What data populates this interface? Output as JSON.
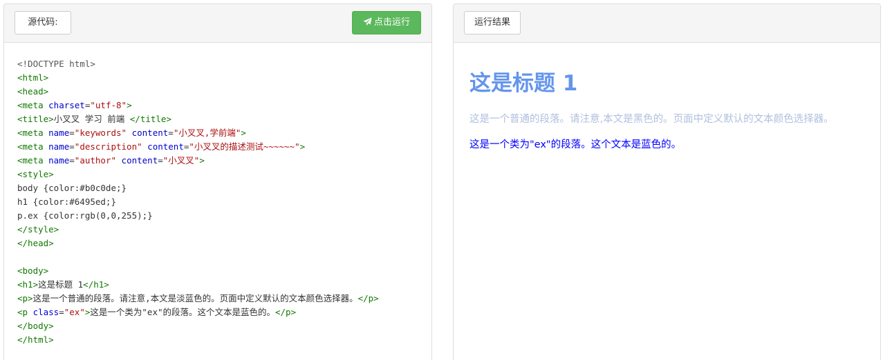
{
  "source_panel": {
    "label": "源代码:",
    "run_button": "点击运行",
    "code": [
      [
        [
          "meta",
          "<!DOCTYPE html>"
        ]
      ],
      [
        [
          "tag",
          "<html>"
        ]
      ],
      [
        [
          "tag",
          "<head>"
        ]
      ],
      [
        [
          "tag",
          "<meta "
        ],
        [
          "attr",
          "charset"
        ],
        [
          "prop",
          "="
        ],
        [
          "str",
          "\"utf-8\""
        ],
        [
          "tag",
          ">"
        ]
      ],
      [
        [
          "tag",
          "<title>"
        ],
        [
          "prop",
          "小叉叉 学习 前端 "
        ],
        [
          "tag",
          "</title>"
        ]
      ],
      [
        [
          "tag",
          "<meta "
        ],
        [
          "attr",
          "name"
        ],
        [
          "prop",
          "="
        ],
        [
          "str",
          "\"keywords\""
        ],
        [
          "prop",
          " "
        ],
        [
          "attr",
          "content"
        ],
        [
          "prop",
          "="
        ],
        [
          "str",
          "\"小叉叉,学前端\""
        ],
        [
          "tag",
          ">"
        ]
      ],
      [
        [
          "tag",
          "<meta "
        ],
        [
          "attr",
          "name"
        ],
        [
          "prop",
          "="
        ],
        [
          "str",
          "\"description\""
        ],
        [
          "prop",
          " "
        ],
        [
          "attr",
          "content"
        ],
        [
          "prop",
          "="
        ],
        [
          "str",
          "\"小叉叉的描述测试~~~~~~\""
        ],
        [
          "tag",
          ">"
        ]
      ],
      [
        [
          "tag",
          "<meta "
        ],
        [
          "attr",
          "name"
        ],
        [
          "prop",
          "="
        ],
        [
          "str",
          "\"author\""
        ],
        [
          "prop",
          " "
        ],
        [
          "attr",
          "content"
        ],
        [
          "prop",
          "="
        ],
        [
          "str",
          "\"小叉叉\""
        ],
        [
          "tag",
          ">"
        ]
      ],
      [
        [
          "tag",
          "<style>"
        ]
      ],
      [
        [
          "prop",
          "body {color:#b0c0de;}"
        ]
      ],
      [
        [
          "prop",
          "h1 {color:#6495ed;}"
        ]
      ],
      [
        [
          "prop",
          "p.ex {color:rgb(0,0,255);}"
        ]
      ],
      [
        [
          "tag",
          "</style>"
        ]
      ],
      [
        [
          "tag",
          "</head>"
        ]
      ],
      [
        [
          "prop",
          ""
        ]
      ],
      [
        [
          "tag",
          "<body>"
        ]
      ],
      [
        [
          "tag",
          "<h1>"
        ],
        [
          "prop",
          "这是标题 1"
        ],
        [
          "tag",
          "</h1>"
        ]
      ],
      [
        [
          "tag",
          "<p>"
        ],
        [
          "prop",
          "这是一个普通的段落。请注意,本文是淡蓝色的。页面中定义默认的文本颜色选择器。"
        ],
        [
          "tag",
          "</p>"
        ]
      ],
      [
        [
          "tag",
          "<p "
        ],
        [
          "attr",
          "class"
        ],
        [
          "prop",
          "="
        ],
        [
          "str",
          "\"ex\""
        ],
        [
          "tag",
          ">"
        ],
        [
          "prop",
          "这是一个类为\"ex\"的段落。这个文本是蓝色的。"
        ],
        [
          "tag",
          "</p>"
        ]
      ],
      [
        [
          "tag",
          "</body>"
        ]
      ],
      [
        [
          "tag",
          "</html>"
        ]
      ]
    ]
  },
  "result_panel": {
    "label": "运行结果",
    "heading": "这是标题 1",
    "paragraph": "这是一个普通的段落。请注意,本文是黑色的。页面中定义默认的文本颜色选择器。",
    "paragraph_ex": "这是一个类为\"ex\"的段落。这个文本是蓝色的。"
  },
  "colors": {
    "run_button": "#5cb85c",
    "heading": "#6495ed",
    "body_text": "#b0c0de",
    "ex_text": "#0000ff"
  },
  "icons": {
    "run_button_icon": "paper-plane-icon"
  }
}
